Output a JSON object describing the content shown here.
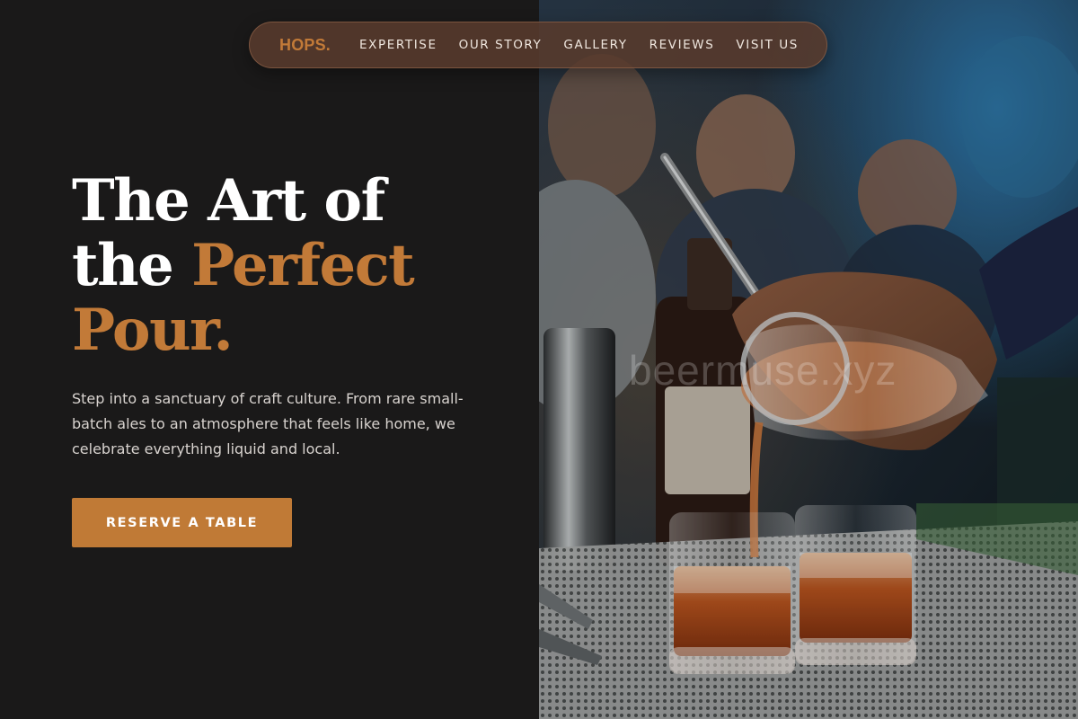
{
  "nav": {
    "brand": "HOPS.",
    "links": [
      {
        "label": "EXPERTISE"
      },
      {
        "label": "OUR STORY"
      },
      {
        "label": "GALLERY"
      },
      {
        "label": "REVIEWS"
      },
      {
        "label": "VISIT US"
      }
    ]
  },
  "hero": {
    "headline_line1": "The Art of",
    "headline_line2_white": "the ",
    "headline_line2_accent": "Perfect",
    "headline_line3_accent": "Pour.",
    "subtext": "Step into a sanctuary of craft culture. From rare small-batch ales to an atmosphere that feels like home, we celebrate everything liquid and local.",
    "cta_label": "RESERVE A TABLE"
  },
  "image": {
    "watermark": "beermuse.xyz"
  },
  "colors": {
    "background": "#1a1919",
    "accent": "#c27a38",
    "button": "#c07a36",
    "nav_pill": "#583a2c"
  }
}
